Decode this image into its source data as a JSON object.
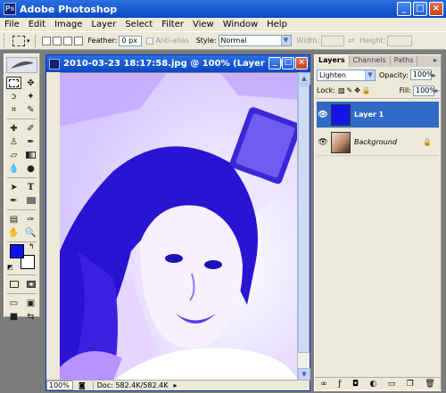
{
  "app": {
    "title": "Adobe Photoshop",
    "icon_text": "Ps"
  },
  "window_buttons": {
    "minimize": "_",
    "maximize": "□",
    "close": "×"
  },
  "menu": [
    "File",
    "Edit",
    "Image",
    "Layer",
    "Select",
    "Filter",
    "View",
    "Window",
    "Help"
  ],
  "options": {
    "feather_label": "Feather:",
    "feather_value": "0 px",
    "antialias_label": "Anti-alias",
    "style_label": "Style:",
    "style_value": "Normal",
    "width_label": "Width:",
    "height_label": "Height:"
  },
  "document": {
    "title": "2010-03-23 18:17:58.jpg @ 100% (Layer 1, RG...",
    "zoom": "100%",
    "doc_info": "Doc: 582.4K/582.4K"
  },
  "layers_panel": {
    "tabs": [
      "Layers",
      "Channels",
      "Paths"
    ],
    "blend_mode": "Lighten",
    "opacity_label": "Opacity:",
    "opacity_value": "100%",
    "lock_label": "Lock:",
    "fill_label": "Fill:",
    "fill_value": "100%",
    "layers": [
      {
        "name": "Layer 1",
        "selected": true,
        "thumb_color": "#1414e6"
      },
      {
        "name": "Background",
        "selected": false,
        "thumb_color": "#b98a6a"
      }
    ]
  },
  "colors": {
    "foreground": "#0a14e8",
    "background": "#ffffff",
    "accent": "#0a48c6"
  }
}
